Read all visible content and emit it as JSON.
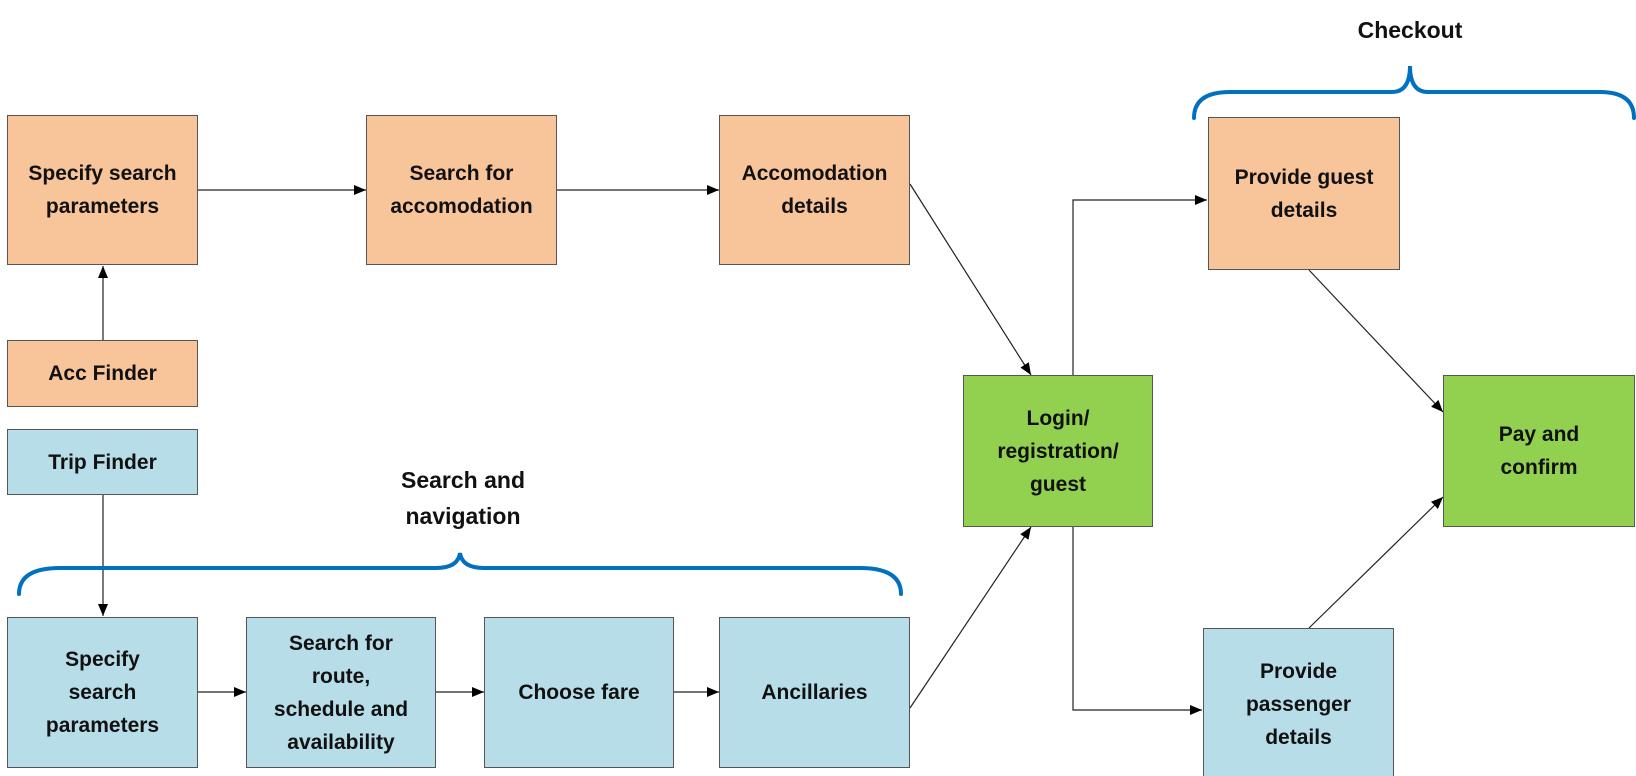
{
  "colors": {
    "accommodation": "#F8C49A",
    "trip": "#B7DDE8",
    "shared": "#92D050",
    "brace": "#0070C0"
  },
  "groups": {
    "checkout": "Checkout",
    "search_navigation": "Search and\nnavigation"
  },
  "nodes": {
    "acc_specify": "Specify search\nparameters",
    "acc_search": "Search for\naccomodation",
    "acc_details": "Accomodation\ndetails",
    "acc_finder": "Acc Finder",
    "trip_finder": "Trip Finder",
    "trip_specify": "Specify\nsearch\nparameters",
    "trip_search": "Search for\nroute,\nschedule and\navailability",
    "choose_fare": "Choose fare",
    "ancillaries": "Ancillaries",
    "login": "Login/\nregistration/\nguest",
    "guest_details": "Provide guest\ndetails",
    "passenger_details": "Provide\npassenger\ndetails",
    "pay": "Pay and\nconfirm"
  }
}
